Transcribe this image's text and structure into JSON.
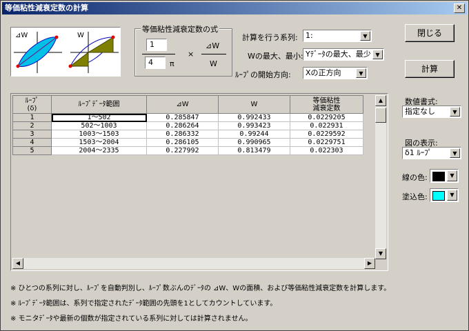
{
  "window": {
    "title": "等価粘性減衰定数の計算",
    "close_label": "✕"
  },
  "diagram": {
    "left_label": "⊿W",
    "right_label": "W"
  },
  "formula": {
    "group_title": "等価粘性減衰定数の式",
    "numerator_value": "1",
    "denominator_value": "4",
    "pi": "π",
    "times": "×",
    "dw": "⊿W",
    "w": "W"
  },
  "settings": {
    "series_label": "計算を行う系列:",
    "series_value": "1:",
    "minmax_label": "Wの最大、最小:",
    "minmax_value": "Yﾃﾞｰﾀの最大、最少",
    "direction_label": "ﾙｰﾌﾟの開始方向:",
    "direction_value": "Xの正方向"
  },
  "buttons": {
    "close": "閉じる",
    "calculate": "計算"
  },
  "right_panel": {
    "number_format_label": "数値書式:",
    "number_format_value": "指定なし",
    "display_label": "図の表示:",
    "display_value": "δ1 ﾙｰﾌﾟ",
    "line_color_label": "線の色:",
    "line_color": "#000000",
    "fill_color_label": "塗込色:",
    "fill_color": "#00ffff"
  },
  "table": {
    "headers": [
      "ﾙｰﾌﾟ\n(δ)",
      "ﾙｰﾌﾟﾃﾞｰﾀ範囲",
      "⊿W",
      "W",
      "等価粘性\n減衰定数"
    ],
    "rows": [
      [
        "1",
        "1〜502",
        "0.285847",
        "0.992433",
        "0.0229205"
      ],
      [
        "2",
        "502〜1003",
        "0.286264",
        "0.993423",
        "0.022931"
      ],
      [
        "3",
        "1003〜1503",
        "0.286332",
        "0.99244",
        "0.0229592"
      ],
      [
        "4",
        "1503〜2004",
        "0.286105",
        "0.990965",
        "0.0229751"
      ],
      [
        "5",
        "2004〜2335",
        "0.227992",
        "0.813479",
        "0.022303"
      ]
    ]
  },
  "notes": [
    "※ ひとつの系列に対し、ﾙｰﾌﾟを自動判別し、ﾙｰﾌﾟ数ぶんのﾃﾞｰﾀの ⊿W、Wの面積、および等価粘性減衰定数を計算します。",
    "※ ﾙｰﾌﾟﾃﾞｰﾀ範囲は、系列で指定されたﾃﾞｰﾀ範囲の先頭を1としてカウントしています。",
    "※ モニタﾃﾞｰﾀや最新の個数が指定されている系列に対しては計算されません。"
  ]
}
